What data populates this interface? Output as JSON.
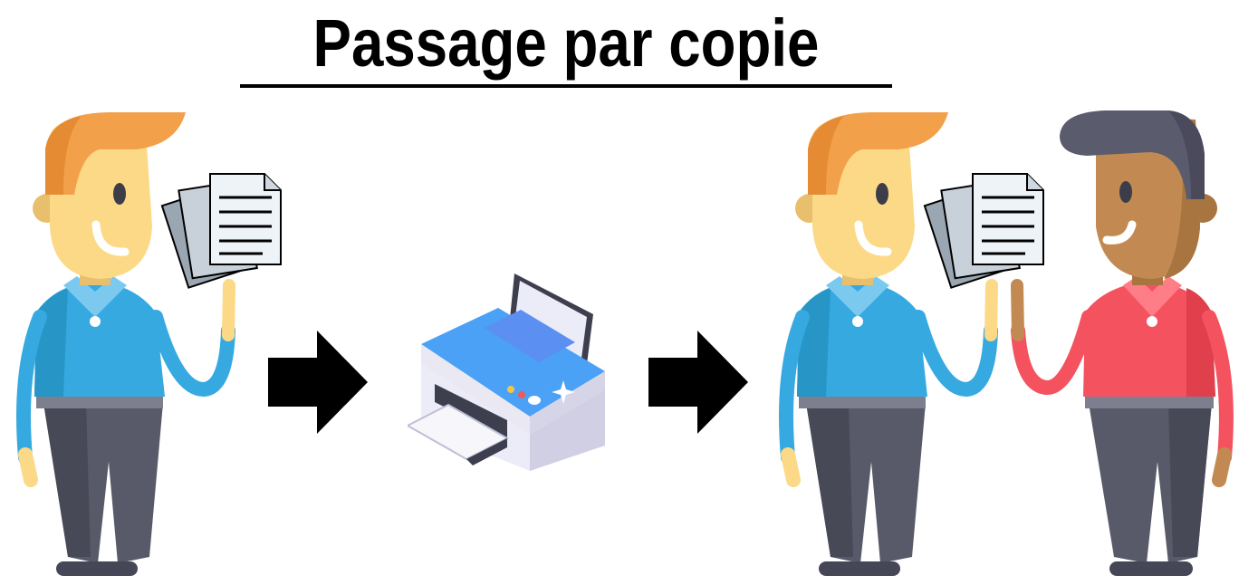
{
  "title": "Passage par copie",
  "icons": {
    "person_left": "man-holding-documents-icon",
    "arrow_1": "right-arrow-icon",
    "printer": "printer-icon",
    "arrow_2": "right-arrow-icon",
    "person_right_blue": "man-holding-documents-icon",
    "person_right_red": "man-icon"
  },
  "colors": {
    "blue_shirt": "#36a9e1",
    "red_shirt": "#f4525f",
    "hair_orange": "#f2a14a",
    "hair_dark": "#5b5b6e",
    "skin_light": "#fcd987",
    "skin_dark": "#c28a52",
    "pants": "#585a6a"
  }
}
